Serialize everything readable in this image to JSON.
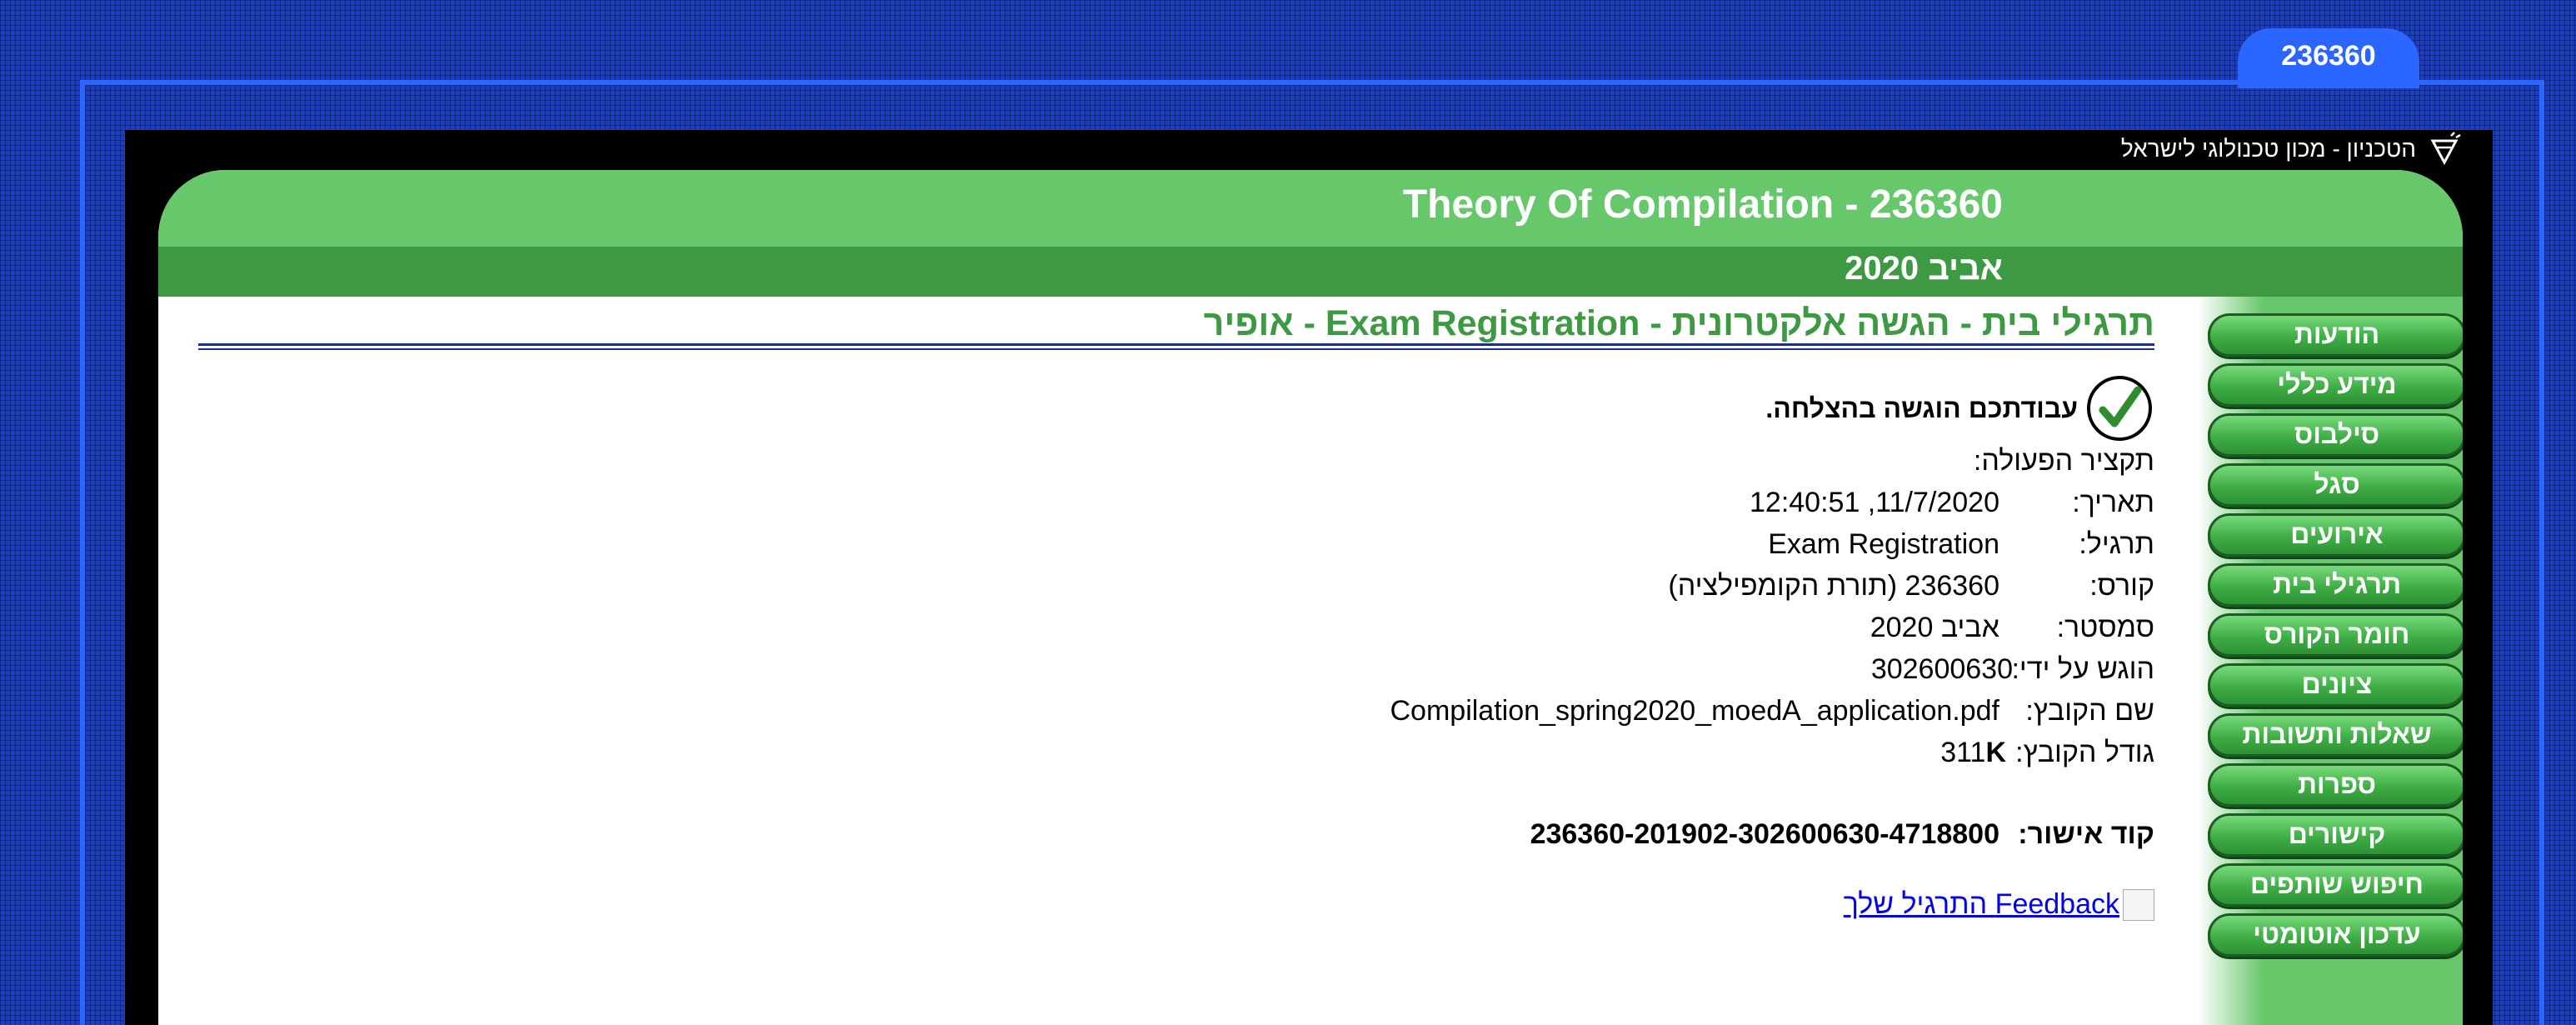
{
  "tab_label": "236360",
  "institution": "הטכניון - מכון טכנולוגי לישראל",
  "course_title": "Theory Of Compilation - 236360",
  "semester_header": "אביב 2020",
  "page_heading": "תרגילי בית - הגשה אלקטרונית - Exam Registration - אופיר",
  "nav": [
    {
      "label": "הודעות"
    },
    {
      "label": "מידע כללי"
    },
    {
      "label": "סילבוס"
    },
    {
      "label": "סגל"
    },
    {
      "label": "אירועים"
    },
    {
      "label": "תרגילי בית"
    },
    {
      "label": "חומר הקורס"
    },
    {
      "label": "ציונים"
    },
    {
      "label": "שאלות ותשובות"
    },
    {
      "label": "ספרות"
    },
    {
      "label": "קישורים"
    },
    {
      "label": "חיפוש שותפים"
    },
    {
      "label": "עדכון אוטומטי"
    }
  ],
  "submission": {
    "success_message": "עבודתכם הוגשה בהצלחה.",
    "summary_label": "תקציר הפעולה:",
    "date_label": "תאריך:",
    "date_value": "11/7/2020, 12:40:51",
    "exercise_label": "תרגיל:",
    "exercise_value": "Exam Registration",
    "course_label": "קורס:",
    "course_value": "236360 (תורת הקומפילציה)",
    "semester_label": "סמסטר:",
    "semester_value": "אביב 2020",
    "submitted_by_label": "הוגש על ידי:",
    "submitted_by_value": "302600630",
    "filename_label": "שם הקובץ:",
    "filename_value": "Compilation_spring2020_moedA_application.pdf",
    "filesize_label": "גודל הקובץ:",
    "filesize_number": "311",
    "filesize_unit": "K",
    "approval_label": "קוד אישור:",
    "approval_value": "236360-201902-302600630-4718800",
    "feedback_link": "Feedback התרגיל שלך"
  },
  "colors": {
    "background": "#1a3fc4",
    "tab": "#2a66ff",
    "header_light": "#66c76b",
    "header_dark": "#3e9a42",
    "heading_text": "#3e9a42",
    "link": "#0000ee"
  }
}
